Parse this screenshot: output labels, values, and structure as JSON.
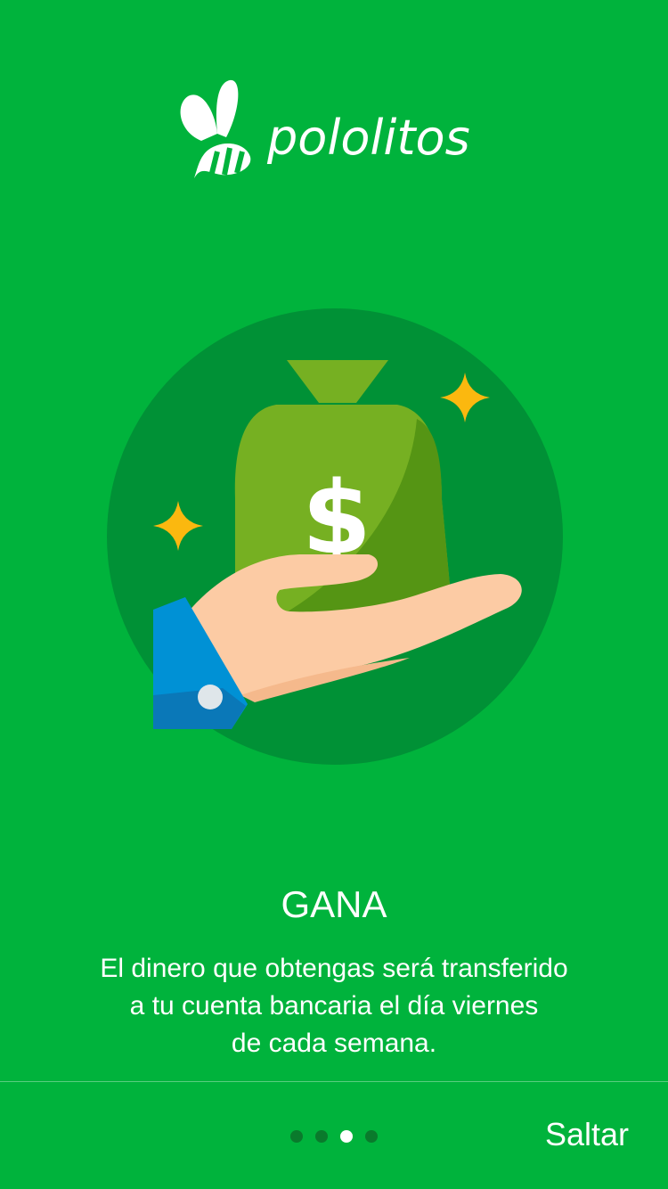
{
  "brand": {
    "name": "pololitos",
    "logo_icon": "bee-icon"
  },
  "onboarding": {
    "illustration_icon": "money-bag-in-hand-icon",
    "bag_symbol": "$",
    "title": "GANA",
    "description_lines": [
      "El dinero que obtengas será transferido",
      "a tu cuenta bancaria el día viernes",
      "de cada semana."
    ],
    "total_pages": 4,
    "current_page": 3
  },
  "footer": {
    "skip_label": "Saltar"
  },
  "colors": {
    "background": "#00b33c",
    "circle": "#009136",
    "bag": "#76b022",
    "bag_shadow": "#559514",
    "hand": "#fccba4",
    "sleeve": "#0091d5",
    "sparkle": "#fbb80f",
    "dot_inactive": "#0a7a2c",
    "dot_active": "#ffffff"
  }
}
